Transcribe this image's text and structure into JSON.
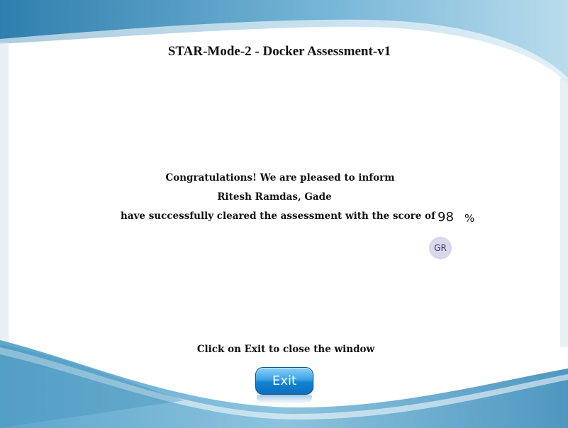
{
  "assessment": {
    "title": "STAR-Mode-2 - Docker Assessment-v1"
  },
  "result": {
    "congrats_text": "Congratulations! We are pleased to inform",
    "candidate_name": "Ritesh Ramdas, Gade",
    "cleared_text": "have successfully cleared the assessment with the score of",
    "score": "98",
    "percent_sign": "%",
    "avatar_initials": "GR"
  },
  "footer": {
    "instruction": "Click on Exit to close the window",
    "exit_label": "Exit"
  },
  "colors": {
    "wave_dark": "#3f8fb8",
    "wave_light": "#8cc4de",
    "button_blue": "#1282d2"
  }
}
